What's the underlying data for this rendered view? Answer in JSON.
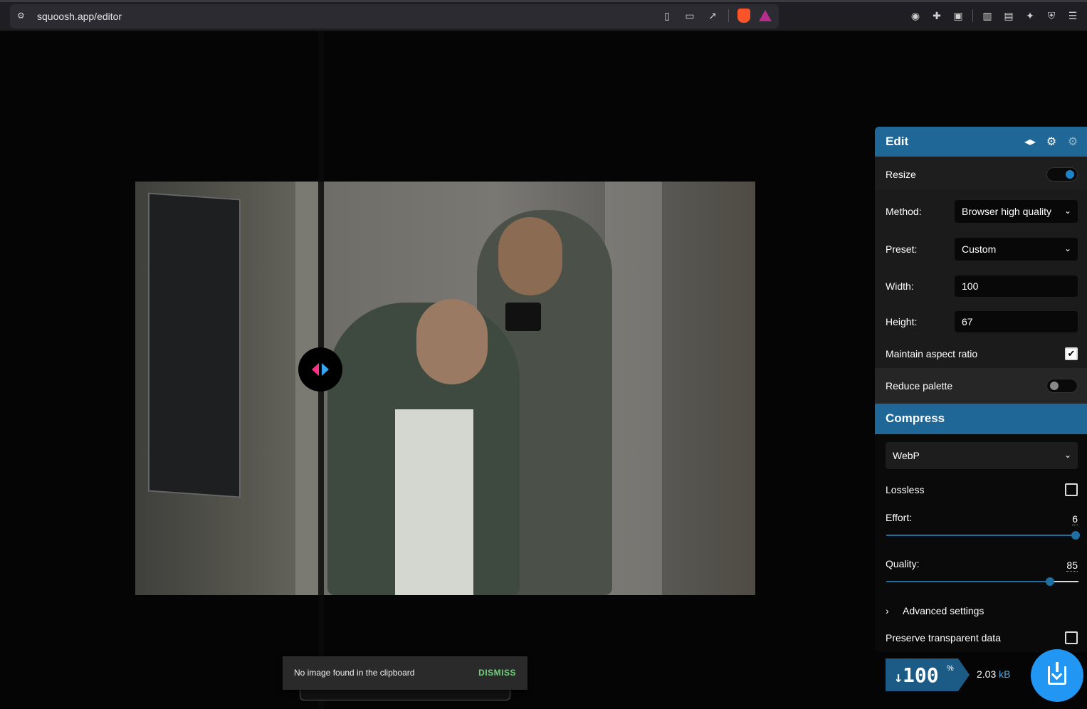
{
  "browser": {
    "url": "squoosh.app/editor"
  },
  "toast": {
    "message": "No image found in the clipboard",
    "dismiss_label": "DISMISS"
  },
  "edit_panel": {
    "title": "Edit",
    "resize_label": "Resize",
    "resize_enabled": true,
    "method_label": "Method:",
    "method_value": "Browser high quality",
    "preset_label": "Preset:",
    "preset_value": "Custom",
    "width_label": "Width:",
    "width_value": "100",
    "height_label": "Height:",
    "height_value": "67",
    "maintain_aspect_label": "Maintain aspect ratio",
    "maintain_aspect_checked": true,
    "reduce_palette_label": "Reduce palette",
    "reduce_palette_enabled": false
  },
  "compress_panel": {
    "title": "Compress",
    "format_value": "WebP",
    "lossless_label": "Lossless",
    "lossless_checked": false,
    "effort_label": "Effort:",
    "effort_value": "6",
    "effort_fraction": 1.0,
    "quality_label": "Quality:",
    "quality_value": "85",
    "quality_fraction": 0.85,
    "advanced_label": "Advanced settings",
    "preserve_label": "Preserve transparent data",
    "preserve_checked": false
  },
  "result": {
    "percent_arrow": "↓",
    "percent_value": "100",
    "percent_sign": "%",
    "size_value": "2.03",
    "size_unit": "kB"
  },
  "colors": {
    "accent": "#1e6796",
    "download_button": "#2196f3",
    "dismiss": "#6dd37a",
    "handle_left": "#ff3385",
    "handle_right": "#34a7f0"
  }
}
